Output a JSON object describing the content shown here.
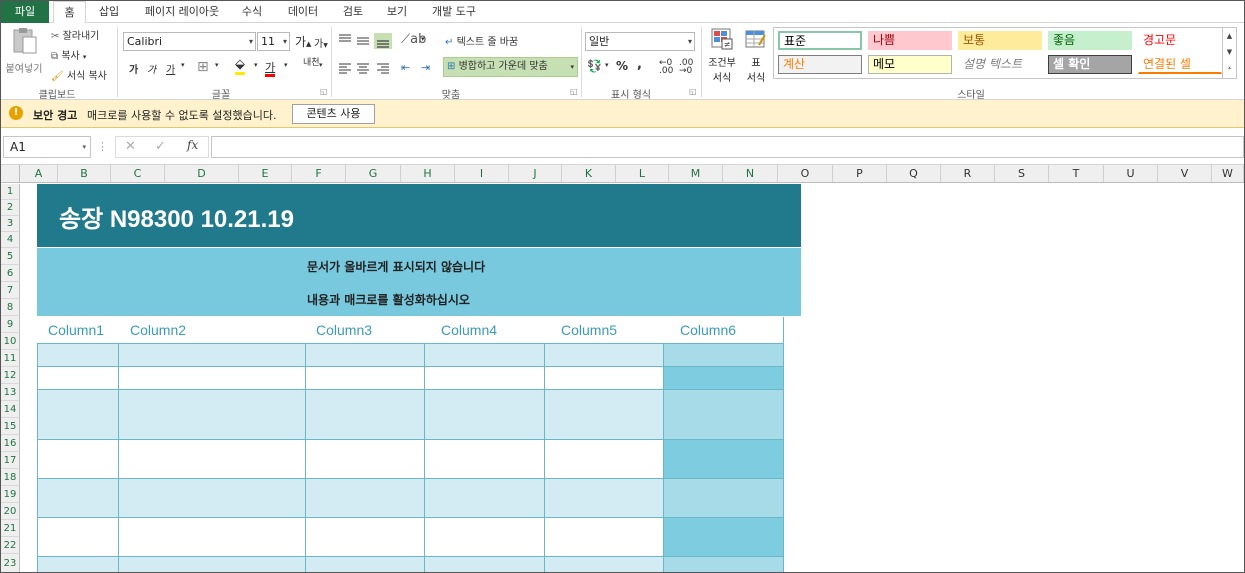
{
  "tabs": [
    "파일",
    "홈",
    "삽입",
    "페이지 레이아웃",
    "수식",
    "데이터",
    "검토",
    "보기",
    "개발 도구"
  ],
  "clipboard": {
    "paste": "붙여넣기",
    "cut": "잘라내기",
    "copy": "복사",
    "format_painter": "서식 복사",
    "label": "클립보드"
  },
  "font": {
    "name": "Calibri",
    "size": "11",
    "grow": "가",
    "shrink": "가",
    "bold": "가",
    "italic": "가",
    "underline": "가",
    "color_a": "가",
    "phonetic": "내천",
    "label": "글꼴"
  },
  "alignment": {
    "wrap": "텍스트 줄 바꿈",
    "merge": "병합하고 가운데 맞춤",
    "label": "맞춤"
  },
  "number": {
    "format": "일반",
    "percent": "%",
    "comma": ",",
    "label": "표시 형식"
  },
  "styles_section": {
    "conditional_line1": "조건부",
    "conditional_line2": "서식",
    "table_line1": "표",
    "table_line2": "서식",
    "label": "스타일"
  },
  "styles": [
    {
      "name": "표준",
      "bg": "#ffffff",
      "fg": "#000000",
      "border": "#88c8a8"
    },
    {
      "name": "나쁨",
      "bg": "#ffc7ce",
      "fg": "#9c0006",
      "border": "#ffc7ce"
    },
    {
      "name": "보통",
      "bg": "#ffeb9c",
      "fg": "#9c5700",
      "border": "#ffeb9c"
    },
    {
      "name": "좋음",
      "bg": "#c6efce",
      "fg": "#006100",
      "border": "#c6efce"
    },
    {
      "name": "경고문",
      "bg": "#ffffff",
      "fg": "#ff0000",
      "border": "#ffffff"
    },
    {
      "name": "계산",
      "bg": "#f2f2f2",
      "fg": "#fa7d00",
      "border": "#7f7f7f"
    },
    {
      "name": "메모",
      "bg": "#ffffcc",
      "fg": "#000000",
      "border": "#b2b2b2"
    },
    {
      "name": "설명 텍스트",
      "bg": "#ffffff",
      "fg": "#7f7f7f",
      "border": "#ffffff"
    },
    {
      "name": "셀 확인",
      "bg": "#a5a5a5",
      "fg": "#ffffff",
      "border": "#3f3f3f"
    },
    {
      "name": "연결된 셀",
      "bg": "#ffffff",
      "fg": "#fa7d00",
      "border": "#ffffff"
    }
  ],
  "security": {
    "title": "보안 경고",
    "message": "매크로를 사용할 수 없도록 설정했습니다.",
    "button": "콘텐츠 사용"
  },
  "formula_bar": {
    "name_box": "A1",
    "fx": "fx",
    "value": ""
  },
  "columns": [
    "A",
    "B",
    "C",
    "D",
    "E",
    "F",
    "G",
    "H",
    "I",
    "J",
    "K",
    "L",
    "M",
    "N",
    "O",
    "P",
    "Q",
    "R",
    "S",
    "T",
    "U",
    "V",
    "W"
  ],
  "rows": [
    "1",
    "2",
    "3",
    "4",
    "5",
    "6",
    "7",
    "8",
    "9",
    "10",
    "11",
    "12",
    "13",
    "14",
    "15",
    "16",
    "17",
    "18",
    "19",
    "20",
    "21",
    "22",
    "23"
  ],
  "sheet": {
    "title": "송장 N98300 10.21.19",
    "notice_line1": "문서가 올바르게 표시되지 않습니다",
    "notice_line2": "내용과 매크로를 활성화하십시오",
    "table_headers": [
      "Column1",
      "Column2",
      "Column3",
      "Column4",
      "Column5",
      "Column6"
    ]
  },
  "colors": {
    "excel_green": "#217346",
    "title_band": "#217a8c",
    "notice_band": "#78c9de",
    "stripe": "#d3ecf3",
    "col6_dark": "#7dcce0",
    "col6_light": "#a8dbe8",
    "header_text": "#3a9cb4",
    "security_bar": "#fff2cc"
  }
}
